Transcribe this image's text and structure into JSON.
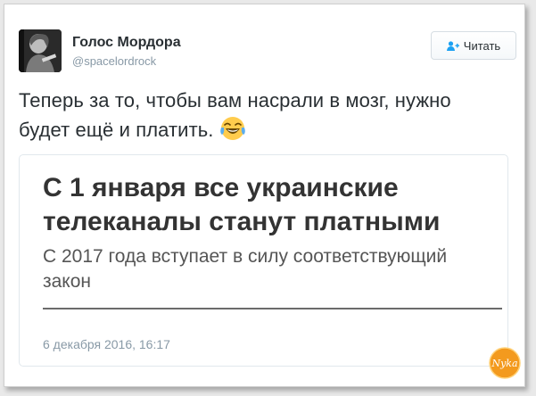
{
  "author": {
    "display_name": "Голос Мордора",
    "handle": "@spacelordrock"
  },
  "follow_button": {
    "label": "Читать",
    "icon": "follow-user-icon",
    "accent": "#1da1f2"
  },
  "tweet": {
    "text": "Теперь за то, чтобы вам насрали в мозг, нужно будет ещё и платить.",
    "emoji": "face-with-tears-of-joy"
  },
  "link_card": {
    "headline": "С 1 января все украинские телеканалы станут платными",
    "description": "С 2017 года вступает в силу соответствующий закон"
  },
  "timestamp": "6 декабря 2016, 16:17",
  "watermark": {
    "text": "Nyka",
    "color": "#f39a1e"
  }
}
